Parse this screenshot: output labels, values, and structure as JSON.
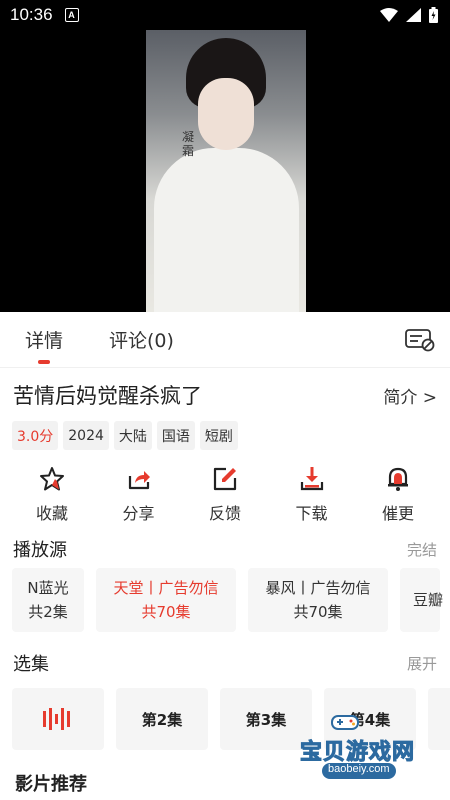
{
  "status": {
    "time": "10:36",
    "badge": "A"
  },
  "video": {
    "watermark_text": "凝霜"
  },
  "tabs": [
    {
      "label": "详情"
    },
    {
      "label": "评论(0)"
    }
  ],
  "detail": {
    "title": "苦情后妈觉醒杀疯了",
    "intro": "简介 >"
  },
  "tags": [
    "3.0分",
    "2024",
    "大陆",
    "国语",
    "短剧"
  ],
  "actions": [
    {
      "label": "收藏",
      "icon": "star-icon"
    },
    {
      "label": "分享",
      "icon": "share-icon"
    },
    {
      "label": "反馈",
      "icon": "edit-icon"
    },
    {
      "label": "下载",
      "icon": "download-icon"
    },
    {
      "label": "催更",
      "icon": "bell-icon"
    }
  ],
  "sources": {
    "heading": "播放源",
    "more": "完结",
    "items": [
      {
        "name": "N蓝光",
        "count": "共2集"
      },
      {
        "name": "天堂丨广告勿信",
        "count": "共70集"
      },
      {
        "name": "暴风丨广告勿信",
        "count": "共70集"
      },
      {
        "name": "豆瓣",
        "count": ""
      }
    ]
  },
  "episodes": {
    "heading": "选集",
    "more": "展开",
    "items": [
      "第2集",
      "第3集",
      "第4集"
    ]
  },
  "recommend": {
    "heading": "影片推荐"
  },
  "watermark": {
    "title": "宝贝游戏网",
    "url": "baobeiy.com"
  },
  "colors": {
    "accent": "#e63b2e",
    "watermark_orange": "#f7a823",
    "watermark_blue": "#2c6aa0"
  }
}
